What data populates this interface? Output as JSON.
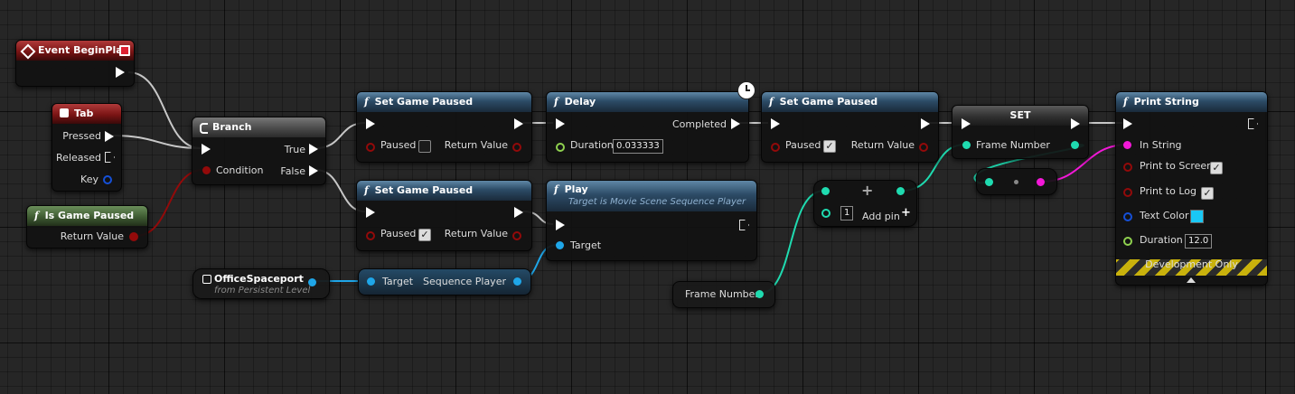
{
  "colors": {
    "exec": "#ffffff",
    "bool": "#930a0a",
    "object": "#1fa6e8",
    "float": "#8fd14f",
    "int": "#1fdbb0",
    "string": "#f318d8",
    "linear_color": "#0b4fd6"
  },
  "icons": {
    "event": "diamond-event-icon",
    "function": "function-f-icon",
    "branch": "branch-icon",
    "key": "keyboard-key-icon",
    "clock": "clock-icon",
    "actor": "actor-reference-icon",
    "add": "plus-icon"
  },
  "event_begin_play": {
    "title": "Event BeginPlay"
  },
  "tab_key": {
    "title": "Tab",
    "pressed": "Pressed",
    "released": "Released",
    "key": "Key"
  },
  "is_game_paused": {
    "title": "Is Game Paused",
    "return_value": "Return Value"
  },
  "branch": {
    "title": "Branch",
    "condition": "Condition",
    "true_label": "True",
    "false_label": "False"
  },
  "set_paused_1": {
    "title": "Set Game Paused",
    "paused": "Paused",
    "paused_checked": false,
    "return_value": "Return Value"
  },
  "set_paused_2": {
    "title": "Set Game Paused",
    "paused": "Paused",
    "paused_checked": true,
    "return_value": "Return Value"
  },
  "delay": {
    "title": "Delay",
    "completed": "Completed",
    "duration_label": "Duration",
    "duration_value": "0.033333"
  },
  "set_paused_3": {
    "title": "Set Game Paused",
    "paused": "Paused",
    "paused_checked": true,
    "return_value": "Return Value"
  },
  "play": {
    "title": "Play",
    "subtitle": "Target is Movie Scene Sequence Player",
    "target": "Target"
  },
  "office_ref": {
    "title": "OfficeSpaceport",
    "subtitle": "from Persistent Level"
  },
  "seq_getter": {
    "target": "Target",
    "sequence_player": "Sequence Player"
  },
  "add_node": {
    "value": "1",
    "add_pin": "Add pin"
  },
  "frame_number_getter": {
    "label": "Frame Number"
  },
  "set_node": {
    "title": "SET",
    "frame_number": "Frame Number"
  },
  "print_string": {
    "title": "Print String",
    "in_string": "In String",
    "print_to_screen": "Print to Screen",
    "print_to_log": "Print to Log",
    "text_color": "Text Color",
    "duration": "Duration",
    "duration_value": "12.0",
    "development_only": "Development Only",
    "text_color_value": "#19c8f5"
  }
}
